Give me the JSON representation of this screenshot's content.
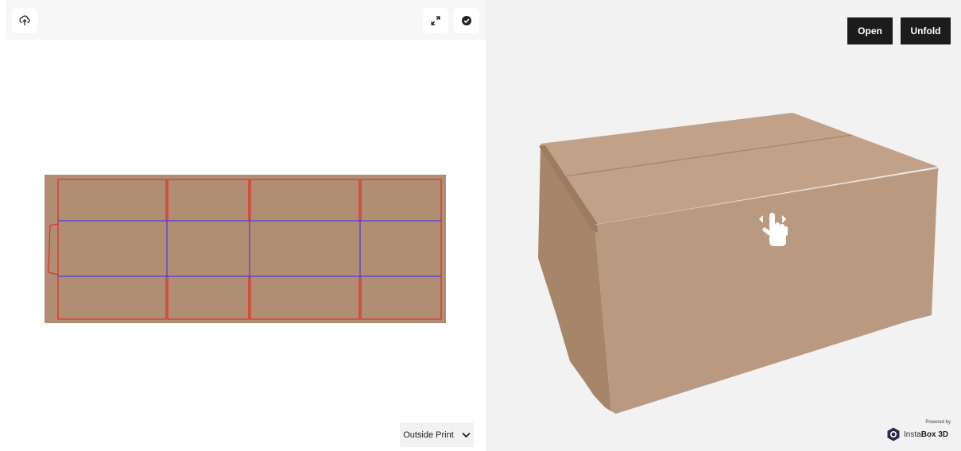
{
  "toolbar": {
    "upload_icon": "upload-icon",
    "expand_icon": "expand-icon",
    "check_icon": "check-circle-icon"
  },
  "print_select": {
    "value": "Outside Print",
    "icon": "chevron-down-icon"
  },
  "viewer": {
    "open_label": "Open",
    "unfold_label": "Unfold",
    "hint_icon": "swipe-hand-icon"
  },
  "branding": {
    "powered_by": "Powered by",
    "brand_prefix": "Insta",
    "brand_bold": "Box 3D"
  },
  "colors": {
    "cardboard": "#b18e73",
    "cut_line": "#e2231a",
    "fold_line": "#2c2cf0",
    "button_dark": "#1c1c1c",
    "viewer_bg": "#f2f2f2"
  }
}
